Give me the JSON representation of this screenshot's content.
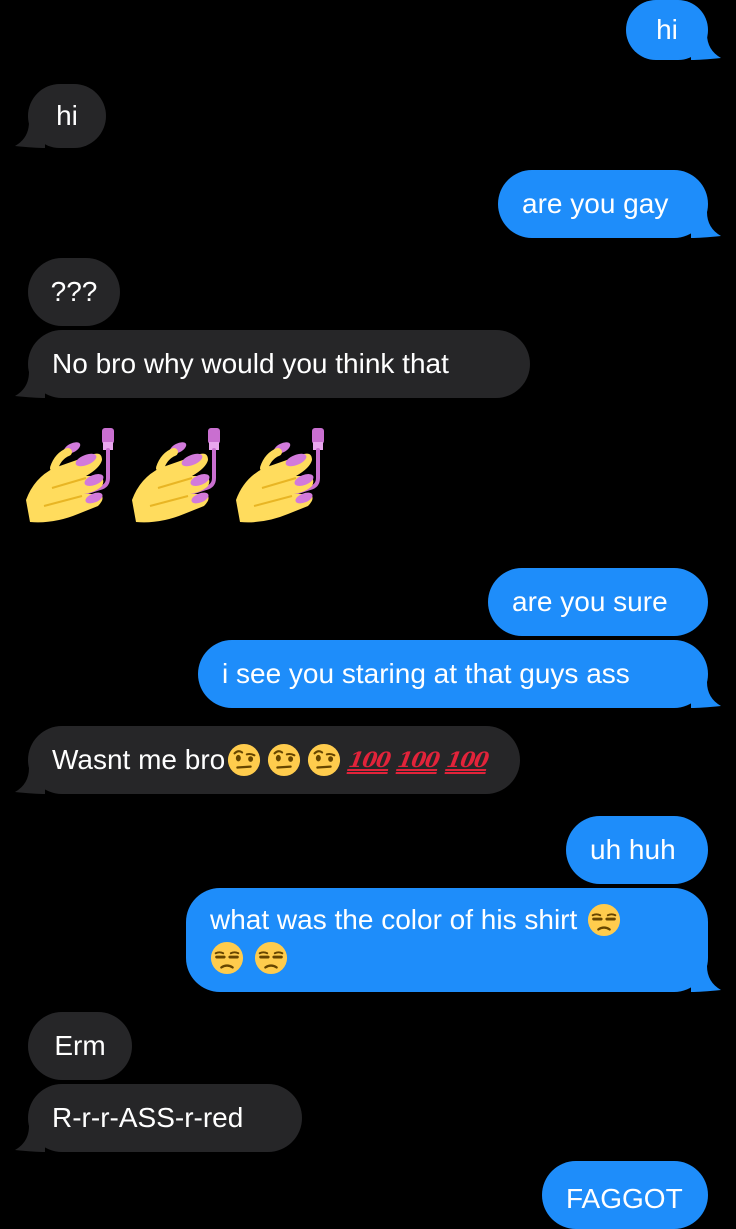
{
  "messages": [
    {
      "id": "m1",
      "side": "sent",
      "text": "hi"
    },
    {
      "id": "m2",
      "side": "received",
      "text": "hi"
    },
    {
      "id": "m3",
      "side": "sent",
      "text": "are you gay"
    },
    {
      "id": "m4",
      "side": "received",
      "text": "???"
    },
    {
      "id": "m5",
      "side": "received",
      "text": "No bro why would you think that"
    },
    {
      "id": "m6",
      "side": "received",
      "emoji": [
        "nail-polish-icon",
        "nail-polish-icon",
        "nail-polish-icon"
      ]
    },
    {
      "id": "m7",
      "side": "sent",
      "text": "are you sure"
    },
    {
      "id": "m8",
      "side": "sent",
      "text": "i see you staring at that guys ass"
    },
    {
      "id": "m9",
      "side": "received",
      "text": "Wasnt me bro",
      "emoji": [
        "face-with-raised-eyebrow-icon",
        "face-with-raised-eyebrow-icon",
        "face-with-raised-eyebrow-icon",
        "hundred-points-icon",
        "hundred-points-icon",
        "hundred-points-icon"
      ],
      "emoji_text": "100"
    },
    {
      "id": "m10",
      "side": "sent",
      "text": "uh huh"
    },
    {
      "id": "m11",
      "side": "sent",
      "text": "what was the color of his shirt",
      "emoji": [
        "unamused-face-icon",
        "unamused-face-icon",
        "unamused-face-icon"
      ]
    },
    {
      "id": "m12",
      "side": "received",
      "text": "Erm"
    },
    {
      "id": "m13",
      "side": "received",
      "text": "R-r-r-ASS-r-red"
    },
    {
      "id": "m14",
      "side": "sent",
      "text": "FAGGOT"
    }
  ],
  "colors": {
    "background": "#000000",
    "sent_bubble": "#1E8DFA",
    "received_bubble": "#262628",
    "text": "#FFFFFF"
  }
}
